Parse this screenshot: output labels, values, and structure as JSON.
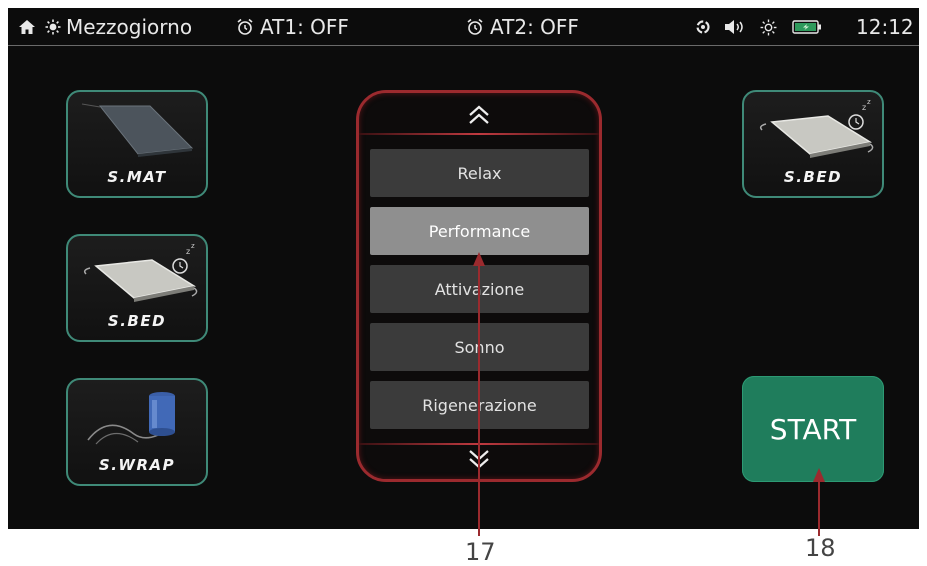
{
  "status": {
    "mode": "Mezzogiorno",
    "alarm1": "AT1: OFF",
    "alarm2": "AT2: OFF",
    "time": "12:12",
    "icons": [
      "home-icon",
      "sun-icon",
      "alarm-clock-icon",
      "sync-icon",
      "speaker-icon",
      "brightness-icon",
      "battery-icon"
    ]
  },
  "devices": {
    "left": [
      {
        "label": "S.MAT"
      },
      {
        "label": "S.BED"
      },
      {
        "label": "S.WRAP"
      }
    ],
    "right": [
      {
        "label": "S.BED"
      }
    ]
  },
  "program_list": {
    "items": [
      "Relax",
      "Performance",
      "Attivazione",
      "Sonno",
      "Rigenerazione"
    ],
    "selected": "Performance"
  },
  "start_button": {
    "label": "START"
  },
  "callouts": {
    "program_list": "17",
    "start_button": "18"
  },
  "colors": {
    "accent_green": "#1f7d5c",
    "tile_border": "#3f8a78",
    "selector_border": "#9b2a2e",
    "annotation": "#9b2a2e"
  }
}
